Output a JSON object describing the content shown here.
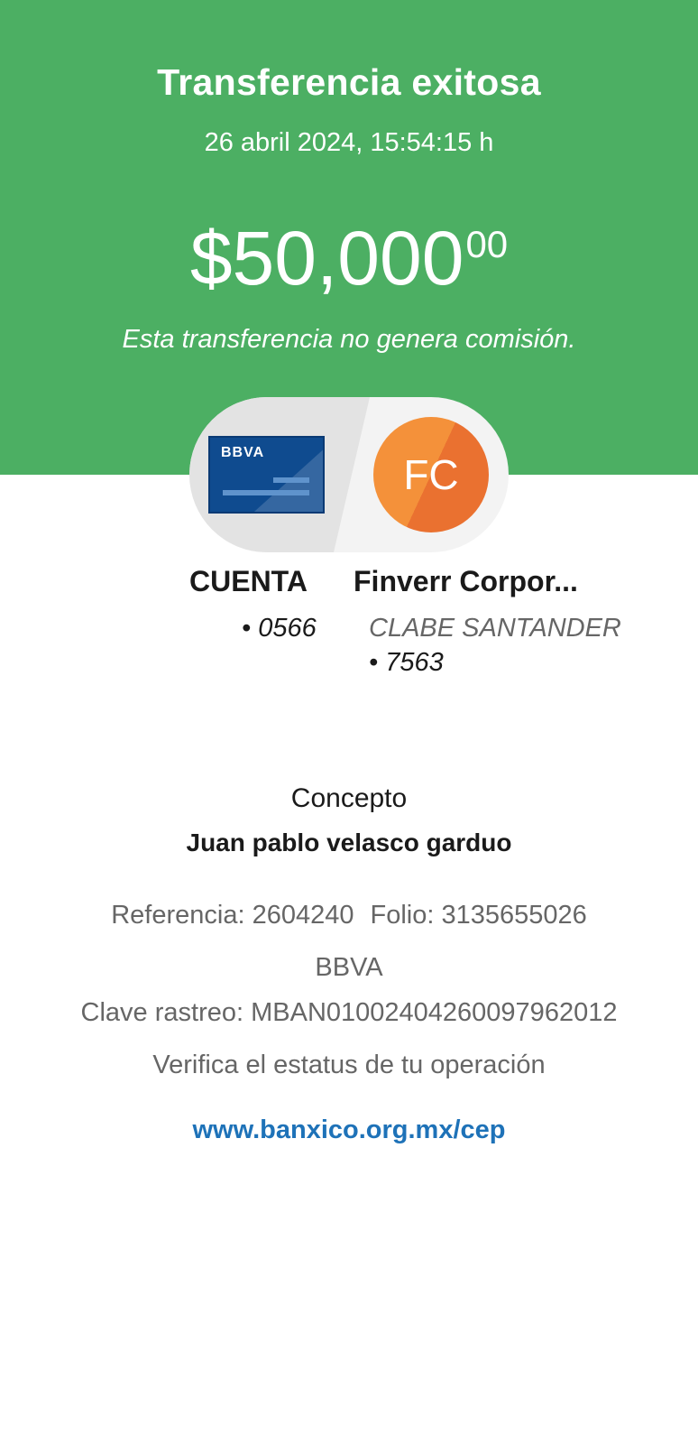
{
  "header": {
    "title": "Transferencia exitosa",
    "datetime": "26 abril 2024, 15:54:15 h",
    "amount_main": "$50,000",
    "amount_cents": "00",
    "fee_note": "Esta transferencia no genera comisión.",
    "background_color": "#4caf63"
  },
  "origin": {
    "card_brand": "BBVA",
    "title": "CUENTA",
    "account": "• 0566",
    "card_color": "#0f4b8f"
  },
  "destination": {
    "initials": "FC",
    "name": "Finverr Corpor...",
    "bank": "CLABE SANTANDER",
    "account": "• 7563",
    "avatar_color": "#ea7130"
  },
  "details": {
    "concept_label": "Concepto",
    "concept_value": "Juan pablo velasco garduo",
    "reference": "Referencia: 2604240",
    "folio": "Folio: 3135655026",
    "bank": "BBVA",
    "trace_key": "Clave rastreo: MBAN01002404260097962012",
    "verify_text": "Verifica el estatus de tu operación",
    "verify_link": "www.banxico.org.mx/cep",
    "link_color": "#1e72b8"
  }
}
